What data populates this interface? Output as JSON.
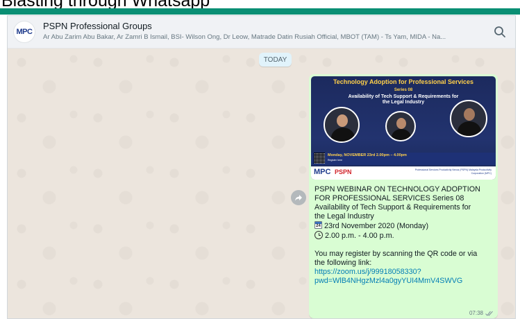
{
  "slide": {
    "title": "Blasting through Whatsapp"
  },
  "header": {
    "avatar_text": "MPC",
    "group_name": "PSPN Professional Groups",
    "members": "Ar Abu Zarim Abu Bakar, Ar Zamri B Ismail, BSI- Wilson Ong, Dr Leow, Matrade Datin Rusiah Official, MBOT (TAM) - Ts Yam, MIDA - Na..."
  },
  "chat": {
    "date_chip": "TODAY",
    "message": {
      "poster": {
        "title": "Technology Adoption for Professional Services",
        "series": "Series 08",
        "subtitle": "Availability of Tech Support & Requirements for the Legal Industry",
        "event_time": "Monday, NOVEMBER 23rd 2.00pm – 4.00pm",
        "register": "Register here",
        "logo_left": "MPC",
        "logo_right": "PSPN",
        "org_text": "Professional Services Productivity Nexus (PSPN) Malaysia Productivity Corporation (MPC)"
      },
      "lines": [
        "PSPN WEBINAR ON TECHNOLOGY ADOPTION",
        "FOR PROFESSIONAL SERVICES Series 08",
        "Availability of Tech Support & Requirements for",
        "the Legal Industry"
      ],
      "date_line": "23rd November 2020 (Monday)",
      "time_line": "2.00 p.m. - 4.00 p.m.",
      "register_lines": [
        "You may register by scanning the QR code or via",
        "the following link:"
      ],
      "link_lines": [
        "https://zoom.us/j/99918058330?",
        "pwd=WlB4NHgzMzl4a0gyYUI4MmV4SWVG"
      ],
      "time": "07:38"
    }
  },
  "colors": {
    "accent": "#0a8f74",
    "bubble": "#d9fdd3",
    "link": "#027eb5"
  }
}
